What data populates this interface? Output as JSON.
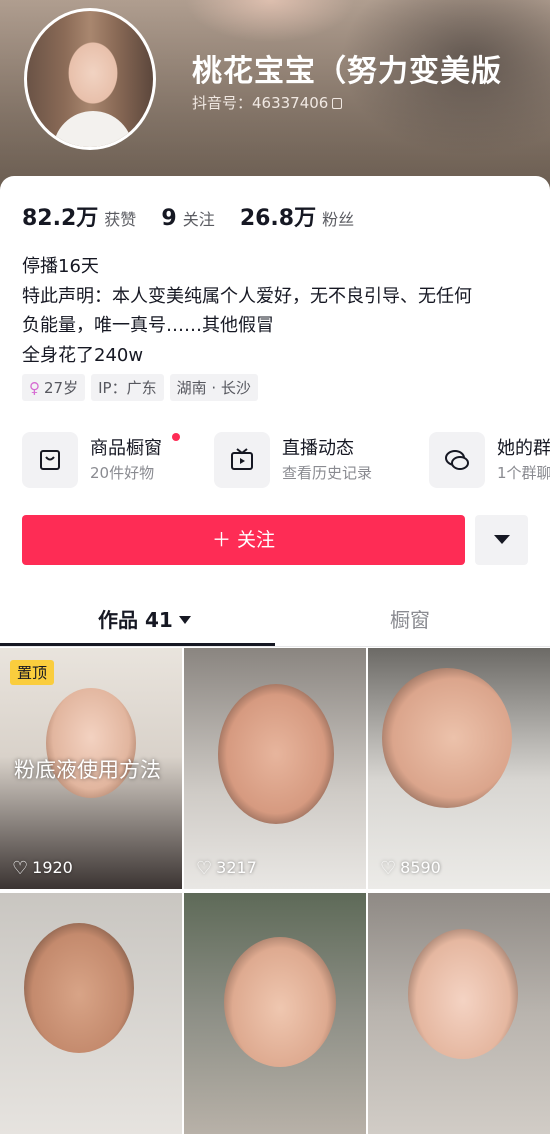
{
  "profile": {
    "nickname": "桃花宝宝（努力变美版",
    "douyin_id": "抖音号：46337406"
  },
  "stats": [
    {
      "value": "82.2万",
      "label": "获赞"
    },
    {
      "value": "9",
      "label": "关注"
    },
    {
      "value": "26.8万",
      "label": "粉丝"
    }
  ],
  "bio": [
    "停播16天",
    "特此声明：本人变美纯属个人爱好，无不良引导、无任何",
    "负能量，唯一真号……其他假冒",
    "全身花了240w"
  ],
  "tags": {
    "age": "27岁",
    "ip": "IP：广东",
    "location": "湖南 · 长沙"
  },
  "shortcuts": [
    {
      "title": "商品橱窗",
      "subtitle": "20件好物",
      "icon": "bag-icon"
    },
    {
      "title": "直播动态",
      "subtitle": "查看历史记录",
      "icon": "tv-icon"
    },
    {
      "title": "她的群",
      "subtitle": "1个群聊",
      "icon": "chat-bubbles-icon"
    }
  ],
  "actions": {
    "follow_label": "＋ 关注"
  },
  "tabs": {
    "works_label": "作品 41",
    "window_label": "橱窗"
  },
  "videos": [
    {
      "likes": "1920",
      "pinned_label": "置顶",
      "overlay_text": "粉底液使用方法"
    },
    {
      "likes": "3217"
    },
    {
      "likes": "8590"
    },
    {},
    {},
    {}
  ],
  "colors": {
    "accent": "#fe2c55",
    "pin_badge": "#facd3d"
  }
}
